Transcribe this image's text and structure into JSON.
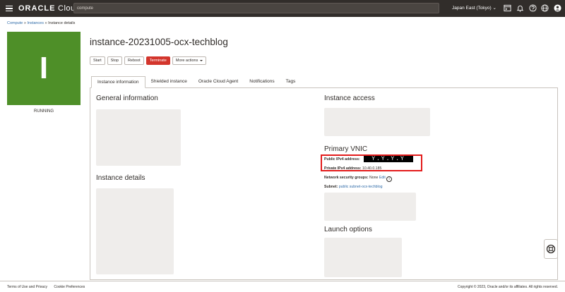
{
  "header": {
    "logo_brand": "ORACLE",
    "logo_product": "Cloud",
    "search_value": "compute",
    "region": "Japan East (Tokyo)",
    "icons": [
      "cloud-shell-icon",
      "bell-icon",
      "help-icon",
      "globe-icon",
      "profile-icon"
    ]
  },
  "breadcrumb": {
    "compute": "Compute",
    "instances": "Instances",
    "current": "Instance details",
    "separator": "»"
  },
  "instance": {
    "initial": "I",
    "state": "RUNNING",
    "name": "instance-20231005-ocx-techblog",
    "state_color": "#4e8f28"
  },
  "actions": {
    "start": "Start",
    "stop": "Stop",
    "reboot": "Reboot",
    "terminate": "Terminate",
    "more": "More actions"
  },
  "tabs": [
    "Instance information",
    "Shielded instance",
    "Oracle Cloud Agent",
    "Notifications",
    "Tags"
  ],
  "sections": {
    "general": "General information",
    "details": "Instance details",
    "access": "Instance access",
    "vnic": "Primary VNIC",
    "launch": "Launch options"
  },
  "vnic": {
    "public_label": "Public IPv4 address:",
    "public_value": "Y.Y.Y.Y",
    "private_label": "Private IPv4 address:",
    "private_value": "10.40.0.185",
    "nsg_label": "Network security groups:",
    "nsg_value": "None",
    "nsg_edit": "Edit",
    "subnet_label": "Subnet:",
    "subnet_value": "public subnet-ocx-techblog"
  },
  "footer": {
    "terms": "Terms of Use and Privacy",
    "cookies": "Cookie Preferences",
    "copyright": "Copyright © 2023, Oracle and/or its affiliates. All rights reserved."
  },
  "colors": {
    "topbar": "#312d2a",
    "danger": "#d3352c",
    "link": "#2f6ba8",
    "highlight": "#e31b1b"
  }
}
